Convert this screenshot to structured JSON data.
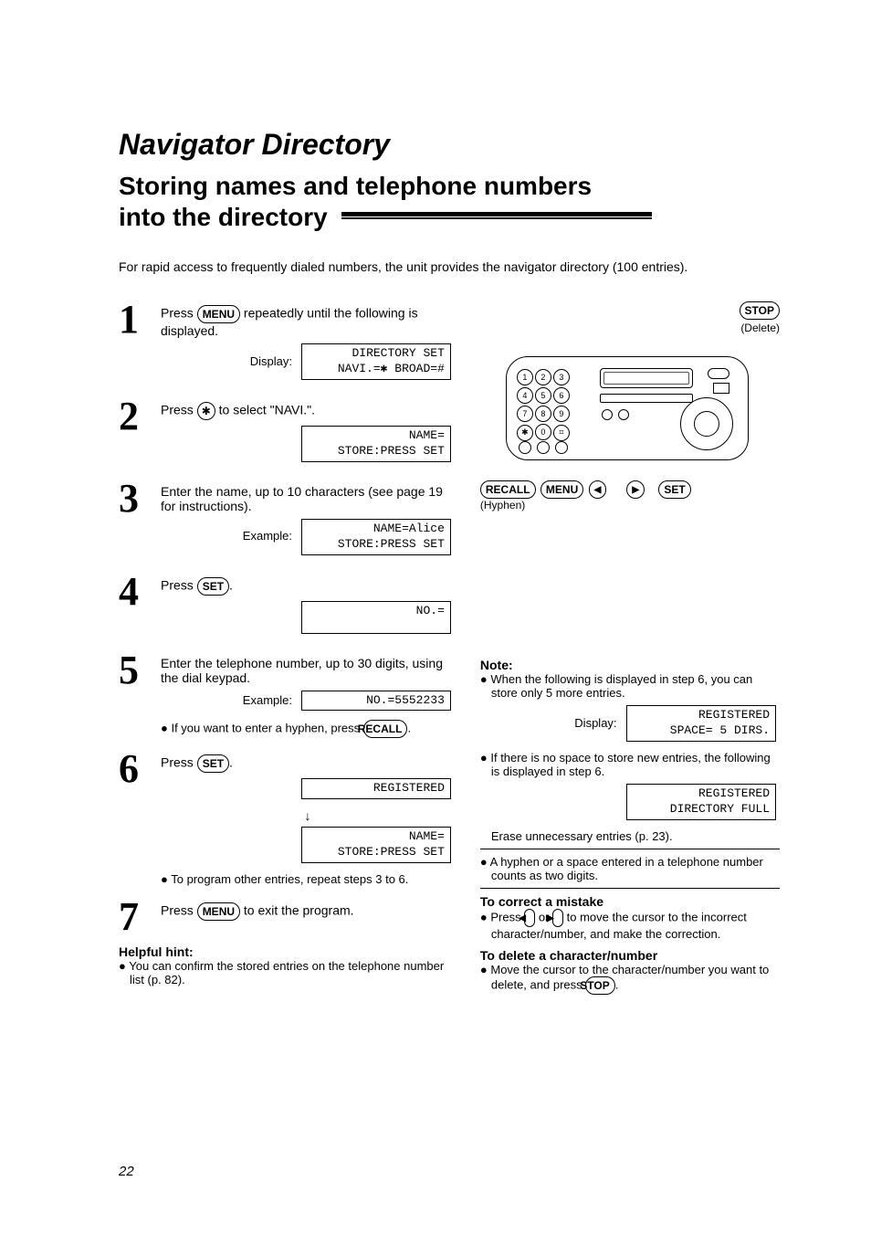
{
  "chapter_title": "Navigator Directory",
  "section_title_l1": "Storing names and telephone numbers",
  "section_title_l2": "into the directory",
  "intro": "For rapid access to frequently dialed numbers, the unit provides the navigator directory (100 entries).",
  "key_menu": "MENU",
  "key_set": "SET",
  "key_recall": "RECALL",
  "key_stop": "STOP",
  "key_star": "✱",
  "steps": {
    "s1": {
      "num": "1",
      "text_a": "Press ",
      "text_b": " repeatedly until the following is displayed.",
      "disp_label": "Display:",
      "disp": "DIRECTORY SET\nNAVI.=✱ BROAD=#"
    },
    "s2": {
      "num": "2",
      "text_a": "Press ",
      "text_b": " to select \"NAVI.\".",
      "disp": "NAME=\nSTORE:PRESS SET"
    },
    "s3": {
      "num": "3",
      "text": "Enter the name, up to 10 characters (see page 19 for instructions).",
      "disp_label": "Example:",
      "disp": "NAME=Alice\nSTORE:PRESS SET"
    },
    "s4": {
      "num": "4",
      "text_a": "Press ",
      "text_b": ".",
      "disp": "NO.="
    },
    "s5": {
      "num": "5",
      "text": "Enter the telephone number, up to 30 digits, using the dial keypad.",
      "disp_label": "Example:",
      "disp": "NO.=5552233",
      "bullet_a": "If you want to enter a hyphen, press ",
      "bullet_b": "."
    },
    "s6": {
      "num": "6",
      "text_a": "Press ",
      "text_b": ".",
      "disp1": "REGISTERED",
      "disp2": "NAME=\nSTORE:PRESS SET",
      "bullet": "To program other entries, repeat steps 3 to 6."
    },
    "s7": {
      "num": "7",
      "text_a": "Press ",
      "text_b": " to exit the program."
    }
  },
  "hint_title": "Helpful hint:",
  "hint_bullet": "You can confirm the stored entries on the telephone number list (p. 82).",
  "device": {
    "stop_sub": "(Delete)",
    "recall_sub": "(Hyphen)",
    "keypad": [
      "1",
      "2",
      "3",
      "4",
      "5",
      "6",
      "7",
      "8",
      "9",
      "✱",
      "0",
      "⌗"
    ]
  },
  "note": {
    "title": "Note:",
    "b1": "When the following is displayed in step 6, you can store only 5 more entries.",
    "d1_label": "Display:",
    "d1": "    REGISTERED\nSPACE= 5 DIRS.",
    "b2": "If there is no space to store new entries, the following is displayed in step 6.",
    "d2": "    REGISTERED\nDIRECTORY FULL",
    "b2b": "Erase unnecessary entries (p. 23).",
    "b3": "A hyphen or a space entered in a telephone number counts as two digits.",
    "correct_title": "To correct a mistake",
    "correct_a": "Press ",
    "correct_b": " or ",
    "correct_c": " to move the cursor to the incorrect character/number, and make the correction.",
    "delete_title": "To delete a character/number",
    "delete_a": "Move the cursor to the character/number you want to delete, and press ",
    "delete_b": "."
  },
  "page_num": "22"
}
